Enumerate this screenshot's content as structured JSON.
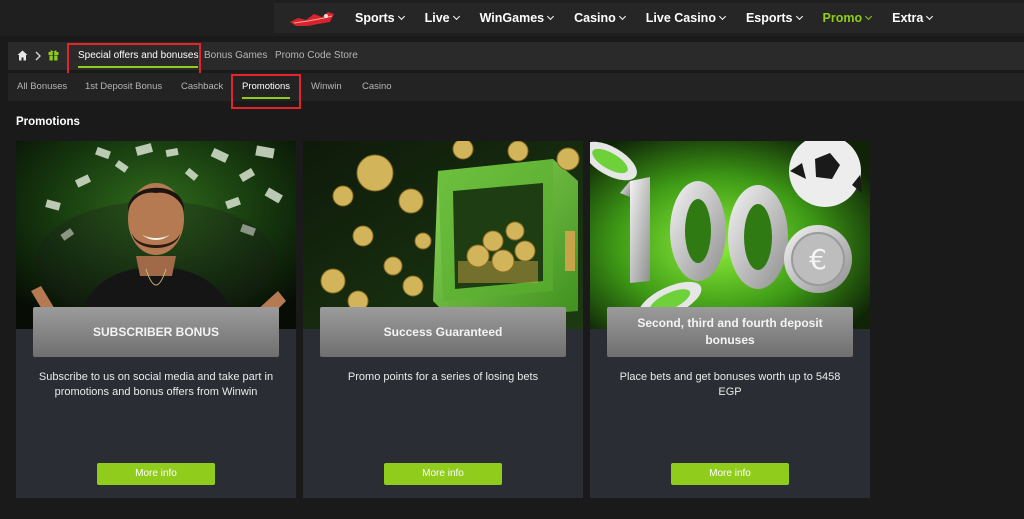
{
  "nav": {
    "items": [
      {
        "label": "Sports"
      },
      {
        "label": "Live"
      },
      {
        "label": "WinGames"
      },
      {
        "label": "Casino"
      },
      {
        "label": "Live Casino"
      },
      {
        "label": "Esports"
      },
      {
        "label": "Promo",
        "active": true
      },
      {
        "label": "Extra"
      }
    ],
    "accent_color": "#8fcc1b"
  },
  "breadcrumb": {
    "home_icon": "home-icon",
    "gift_icon": "gift-icon",
    "items": [
      {
        "label": "Special offers and bonuses",
        "active": true
      },
      {
        "label": "Bonus Games"
      },
      {
        "label": "Promo Code Store"
      }
    ]
  },
  "subtabs": {
    "items": [
      {
        "label": "All Bonuses"
      },
      {
        "label": "1st Deposit Bonus"
      },
      {
        "label": "Cashback"
      },
      {
        "label": "Promotions",
        "active": true
      },
      {
        "label": "Winwin"
      },
      {
        "label": "Casino"
      }
    ]
  },
  "section": {
    "title": "Promotions"
  },
  "cards": [
    {
      "title": "SUBSCRIBER BONUS",
      "description": "Subscribe to us on social media and take part in promotions and bonus offers from Winwin",
      "button": "More info",
      "image": "smiling man with falling banknotes"
    },
    {
      "title": "Success Guaranteed",
      "description": "Promo points for a series of losing bets",
      "button": "More info",
      "image": "green safe with gold coins"
    },
    {
      "title": "Second, third and fourth deposit bonuses",
      "description": "Place bets and get bonuses worth up to 5458 EGP",
      "button": "More info",
      "image": "silver 100 with euro coin, chips and football"
    }
  ],
  "highlight_color": "#e3242b"
}
